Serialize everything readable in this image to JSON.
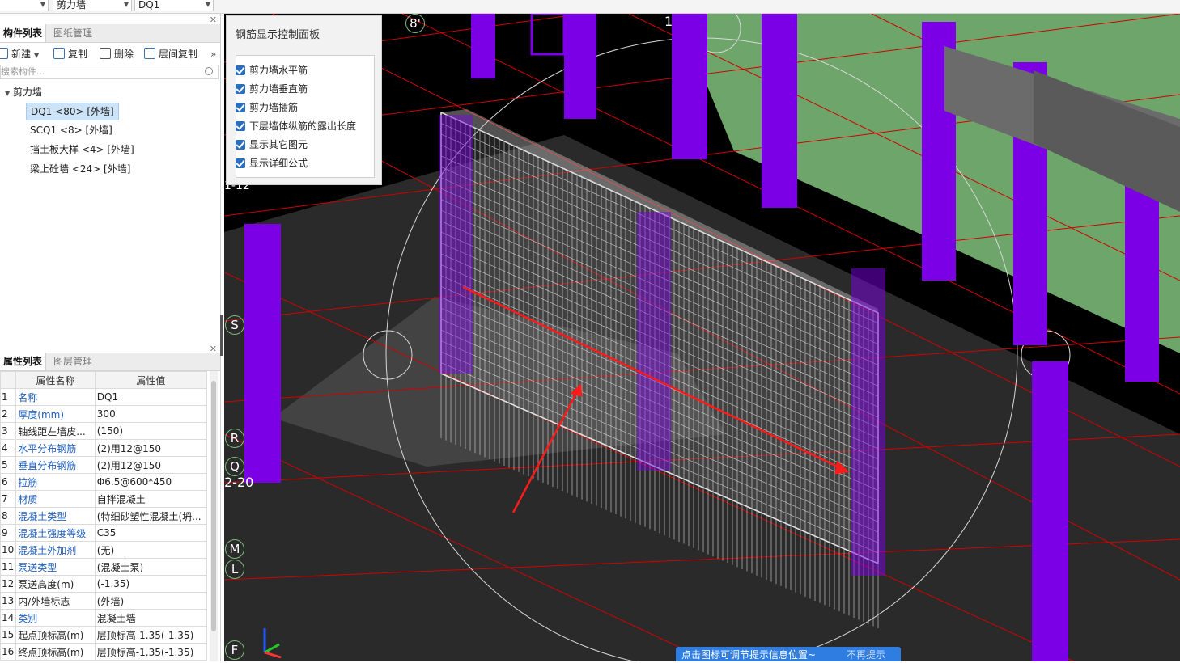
{
  "top_toolbar": {
    "select1": "",
    "select2": "剪力墙",
    "select3": "DQ1"
  },
  "component_panel": {
    "tabs": [
      "构件列表",
      "图纸管理"
    ],
    "toolbar": {
      "new": "新建",
      "copy": "复制",
      "delete": "删除",
      "floor_copy": "层间复制",
      "more": "»"
    },
    "search_placeholder": "搜索构件...",
    "tree_root": "剪力墙",
    "items": [
      "DQ1 <80> [外墙]",
      "SCQ1 <8> [外墙]",
      "挡土板大样 <4> [外墙]",
      "梁上砼墙 <24> [外墙]"
    ],
    "selected_index": 0
  },
  "property_panel": {
    "tabs": [
      "属性列表",
      "图层管理"
    ],
    "headers": [
      "属性名称",
      "属性值"
    ],
    "rows": [
      {
        "num": "1",
        "name": "名称",
        "value": "DQ1",
        "blue": true
      },
      {
        "num": "2",
        "name": "厚度(mm)",
        "value": "300",
        "blue": true
      },
      {
        "num": "3",
        "name": "轴线距左墙皮...",
        "value": "(150)",
        "blue": false
      },
      {
        "num": "4",
        "name": "水平分布钢筋",
        "value": "(2)⽤12@150",
        "blue": true
      },
      {
        "num": "5",
        "name": "垂直分布钢筋",
        "value": "(2)⽤12@150",
        "blue": true
      },
      {
        "num": "6",
        "name": "拉筋",
        "value": "Φ6.5@600*450",
        "blue": true
      },
      {
        "num": "7",
        "name": "材质",
        "value": "自拌混凝土",
        "blue": true
      },
      {
        "num": "8",
        "name": "混凝土类型",
        "value": "(特细砂塑性混凝土(坍...",
        "blue": true
      },
      {
        "num": "9",
        "name": "混凝土强度等级",
        "value": "C35",
        "blue": true
      },
      {
        "num": "10",
        "name": "混凝土外加剂",
        "value": "(无)",
        "blue": true
      },
      {
        "num": "11",
        "name": "泵送类型",
        "value": "(混凝土泵)",
        "blue": true
      },
      {
        "num": "12",
        "name": "泵送高度(m)",
        "value": "(-1.35)",
        "blue": false
      },
      {
        "num": "13",
        "name": "内/外墙标志",
        "value": "(外墙)",
        "blue": false
      },
      {
        "num": "14",
        "name": "类别",
        "value": "混凝土墙",
        "blue": true
      },
      {
        "num": "15",
        "name": "起点顶标高(m)",
        "value": "层顶标高-1.35(-1.35)",
        "blue": false
      },
      {
        "num": "16",
        "name": "终点顶标高(m)",
        "value": "层顶标高-1.35(-1.35)",
        "blue": false
      }
    ]
  },
  "rebar_panel": {
    "title": "钢筋显示控制面板",
    "options": [
      {
        "label": "剪力墙水平筋",
        "checked": true
      },
      {
        "label": "剪力墙垂直筋",
        "checked": true
      },
      {
        "label": "剪力墙插筋",
        "checked": true
      },
      {
        "label": "下层墙体纵筋的露出长度",
        "checked": true
      },
      {
        "label": "显示其它图元",
        "checked": true
      },
      {
        "label": "显示详细公式",
        "checked": true
      }
    ]
  },
  "viewport_labels": {
    "axis_8p": "8'",
    "axis_1": "1",
    "axis_1_12": "1-12",
    "axis_S": "S",
    "axis_R": "R",
    "axis_Q": "Q",
    "axis_2_20": "2-20",
    "axis_M": "M",
    "axis_L": "L",
    "axis_F": "F"
  },
  "tipbar": {
    "message": "点击图标可调节提示信息位置~",
    "dismiss": "不再提示"
  },
  "colors": {
    "column_purple": "#7b00e6",
    "slab_green": "#6da56a",
    "beam_gray": "#6b6b6b",
    "grid_red": "#d40000",
    "accent_blue": "#2f7de1"
  }
}
